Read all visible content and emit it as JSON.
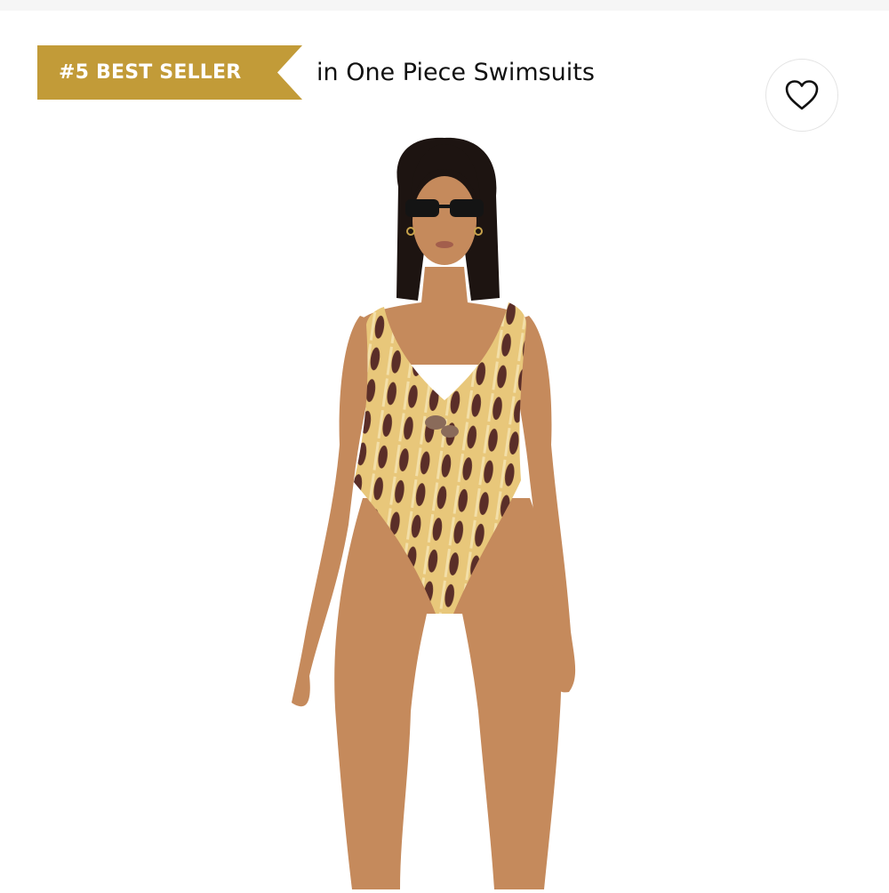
{
  "badge": {
    "label": "#5 BEST SELLER",
    "color": "#C29B38",
    "text_color": "#FFFFFF"
  },
  "rank_context": "in One Piece Swimsuits",
  "wishlist": {
    "icon": "heart-outline-icon"
  },
  "product_image": {
    "alt": "Model wearing a patterned one piece swimsuit",
    "swimsuit_colors": [
      "#E8C77A",
      "#5A2E28"
    ]
  }
}
